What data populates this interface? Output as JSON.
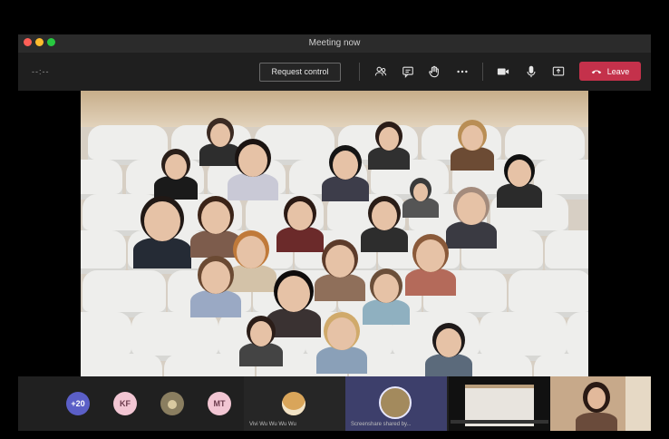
{
  "window": {
    "title": "Meeting now",
    "traffic_lights": [
      "#ff5f57",
      "#febc2e",
      "#28c840"
    ]
  },
  "toolbar": {
    "timer": "--:--",
    "request_control_label": "Request control",
    "leave_label": "Leave",
    "leave_color": "#c4314b",
    "icons": [
      "participants-icon",
      "chat-icon",
      "raise-hand-icon",
      "more-options-icon",
      "camera-icon",
      "microphone-icon",
      "share-screen-icon"
    ]
  },
  "bottom_strip": {
    "overflow_count": "+20",
    "avatars": [
      {
        "initials": "KF",
        "color": "#f2c6d3"
      },
      {
        "initials": "MT",
        "color": "#f2c6d3"
      }
    ],
    "tiles": [
      {
        "caption": "Vivi Wu Wu Wu Wu"
      },
      {
        "caption": "Screenshare shared by..."
      }
    ]
  }
}
